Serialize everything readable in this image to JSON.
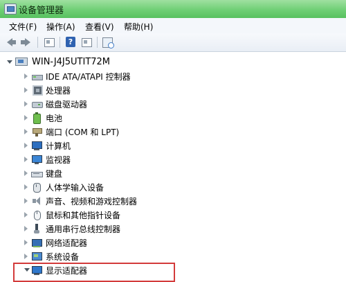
{
  "window": {
    "title": "设备管理器",
    "icon": "device-manager-icon"
  },
  "menu": [
    "文件(F)",
    "操作(A)",
    "查看(V)",
    "帮助(H)"
  ],
  "toolbar": {
    "buttons": [
      "back-icon",
      "forward-icon",
      "properties-icon",
      "help-icon",
      "view-icon",
      "scan-hardware-icon"
    ],
    "help_glyph": "?"
  },
  "tree": {
    "root": {
      "label": "WIN-J4J5UTIT72M",
      "icon": "computer-icon",
      "expanded": true
    },
    "items": [
      {
        "label": "IDE ATA/ATAPI 控制器",
        "icon": "ide-controller-icon",
        "expanded": false
      },
      {
        "label": "处理器",
        "icon": "processor-icon",
        "expanded": false
      },
      {
        "label": "磁盘驱动器",
        "icon": "disk-drive-icon",
        "expanded": false
      },
      {
        "label": "电池",
        "icon": "battery-icon",
        "expanded": false
      },
      {
        "label": "端口 (COM 和 LPT)",
        "icon": "port-icon",
        "expanded": false
      },
      {
        "label": "计算机",
        "icon": "computer-icon",
        "expanded": false
      },
      {
        "label": "监视器",
        "icon": "monitor-icon",
        "expanded": false
      },
      {
        "label": "键盘",
        "icon": "keyboard-icon",
        "expanded": false
      },
      {
        "label": "人体学输入设备",
        "icon": "hid-icon",
        "expanded": false
      },
      {
        "label": "声音、视频和游戏控制器",
        "icon": "sound-icon",
        "expanded": false
      },
      {
        "label": "鼠标和其他指针设备",
        "icon": "mouse-icon",
        "expanded": false
      },
      {
        "label": "通用串行总线控制器",
        "icon": "usb-icon",
        "expanded": false
      },
      {
        "label": "网络适配器",
        "icon": "network-adapter-icon",
        "expanded": false
      },
      {
        "label": "系统设备",
        "icon": "system-device-icon",
        "expanded": false
      },
      {
        "label": "显示适配器",
        "icon": "display-adapter-icon",
        "expanded": true,
        "highlighted": true
      }
    ]
  },
  "colors": {
    "titlebar": "#6fcf75",
    "highlight_border": "#d33a3a"
  }
}
